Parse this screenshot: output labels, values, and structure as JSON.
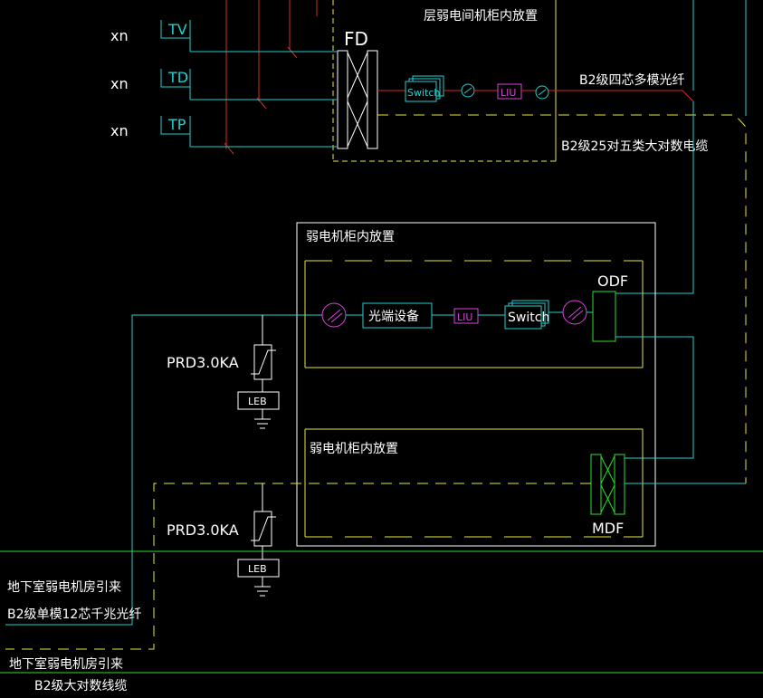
{
  "labels": {
    "top_cabinet": "层弱电间机柜内放置",
    "fd": "FD",
    "xn": "xn",
    "tv": "TV",
    "td": "TD",
    "tp": "TP",
    "switch": "Switch",
    "liu": "LIU",
    "fiber_b2_4core": "B2级四芯多模光纤",
    "cable_b2_25pair": "B2级25对五类大对数电缆",
    "cabinet_upper": "弱电机柜内放置",
    "odf": "ODF",
    "optical_terminal": "光端设备",
    "cabinet_lower": "弱电机柜内放置",
    "mdf": "MDF",
    "prd": "PRD3.0KA",
    "leb": "LEB",
    "basement_from_1": "地下室弱电机房引来",
    "fiber_b2_12core": "B2级单模12芯千兆光纤",
    "basement_from_2": "地下室弱电机房引来",
    "cable_b2_big": "B2级大对数线缆"
  },
  "colors": {
    "background": "#000000",
    "cyan": "#1fd0d0",
    "yellow": "#e8e83a",
    "green": "#2ee02e",
    "red": "#d42a2a",
    "magenta": "#e040e0",
    "white": "#ffffff"
  }
}
